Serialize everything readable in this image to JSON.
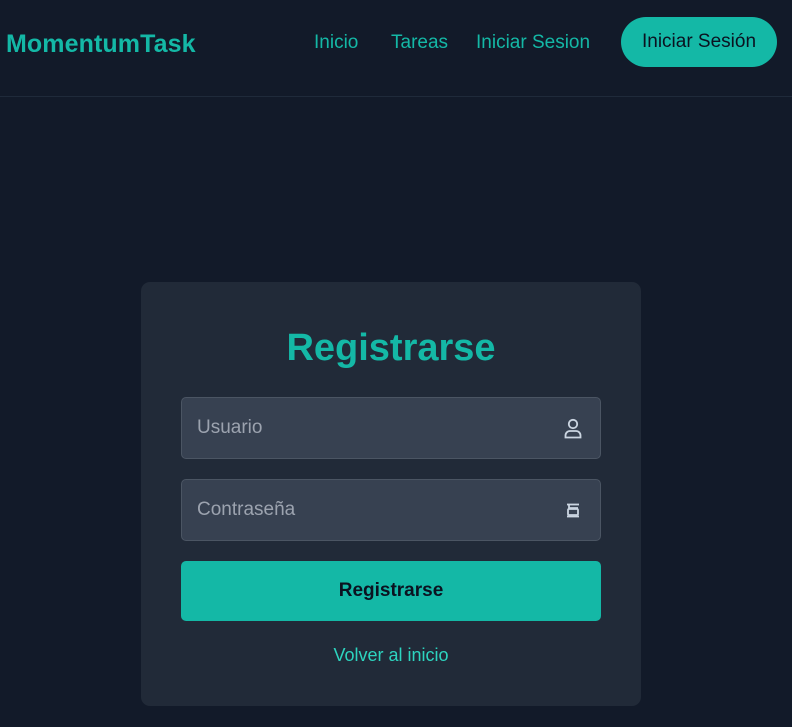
{
  "navbar": {
    "brand": "MomentumTask",
    "links": [
      {
        "label": "Inicio"
      },
      {
        "label": "Tareas"
      },
      {
        "label": "Iniciar Sesion"
      }
    ],
    "cta_label": "Iniciar Sesión"
  },
  "register_form": {
    "title": "Registrarse",
    "username": {
      "placeholder": "Usuario",
      "value": "",
      "icon": "user-icon"
    },
    "password": {
      "placeholder": "Contraseña",
      "value": "",
      "icon": "lock-icon"
    },
    "submit_label": "Registrarse",
    "back_link": "Volver al inicio"
  },
  "colors": {
    "background": "#121a29",
    "card": "#212a38",
    "accent": "#14b8a6",
    "input_bg": "#374151"
  }
}
